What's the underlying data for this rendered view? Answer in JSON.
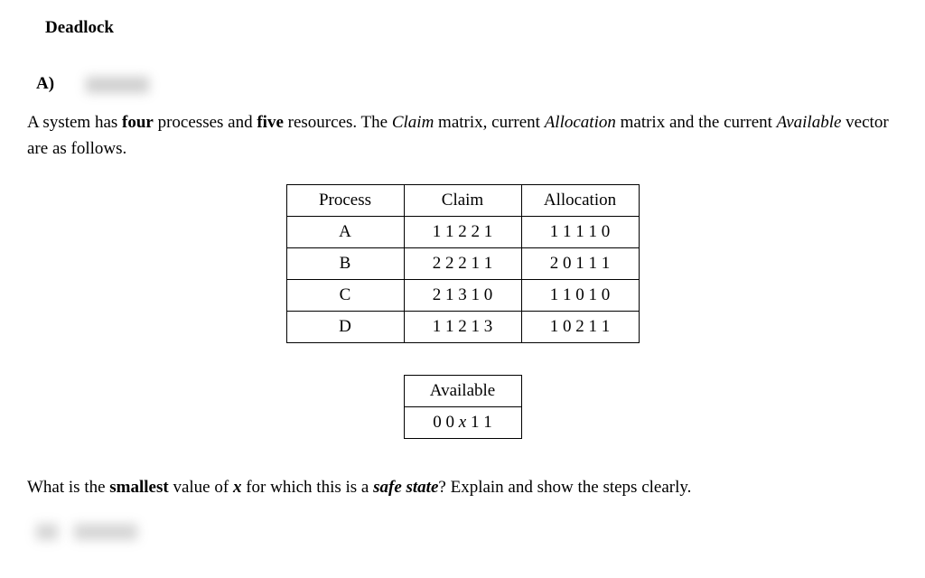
{
  "title": "Deadlock",
  "partLabel": "A)",
  "description": {
    "pre1": "A system has ",
    "bold1": "four",
    "mid1": " processes and ",
    "bold2": "five",
    "mid2": " resources.  The ",
    "italic1": "Claim",
    "mid3": " matrix, current ",
    "italic2": "Allocation",
    "mid4": " matrix and the current ",
    "italic3": "Available",
    "post": " vector are as follows."
  },
  "mainTable": {
    "headers": [
      "Process",
      "Claim",
      "Allocation"
    ],
    "rows": [
      {
        "process": "A",
        "claim": "1 1 2 2 1",
        "allocation": "1 1 1 1 0"
      },
      {
        "process": "B",
        "claim": "2 2 2 1 1",
        "allocation": "2 0 1 1 1"
      },
      {
        "process": "C",
        "claim": "2 1 3 1 0",
        "allocation": "1 1 0 1 0"
      },
      {
        "process": "D",
        "claim": "1 1 2 1 3",
        "allocation": "1 0 2 1 1"
      }
    ]
  },
  "availableTable": {
    "header": "Available",
    "pre": "0 0 ",
    "var": "x",
    "post": " 1 1"
  },
  "question": {
    "pre": "What is the ",
    "bold1": "smallest",
    "mid1": " value of ",
    "var": "x",
    "mid2": " for which this is a ",
    "italicBold": "safe state",
    "post": "?  Explain and show the steps clearly."
  }
}
